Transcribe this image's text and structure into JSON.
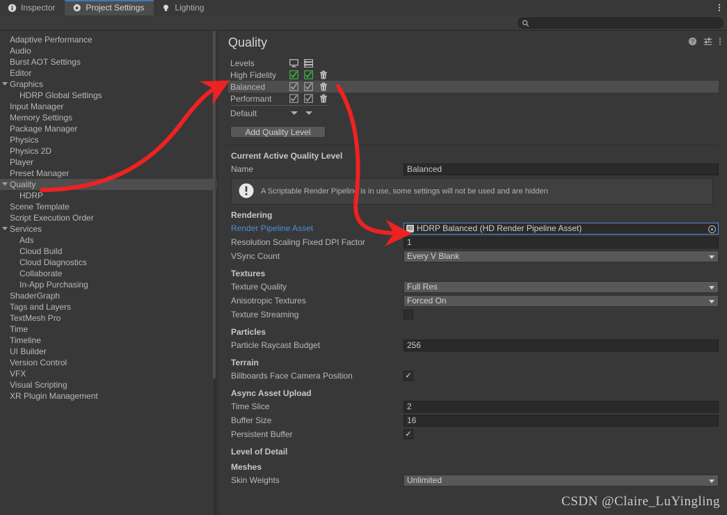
{
  "window": {
    "tabs": [
      {
        "label": "Inspector",
        "icon": "info-icon",
        "active": false
      },
      {
        "label": "Project Settings",
        "icon": "gear-icon",
        "active": true
      },
      {
        "label": "Lighting",
        "icon": "lightbulb-icon",
        "active": false
      }
    ],
    "menu_icon": "kebab-menu-icon"
  },
  "search": {
    "value": "",
    "placeholder": "",
    "icon": "search-icon"
  },
  "sidebar": {
    "items": [
      {
        "label": "Adaptive Performance",
        "indent": 0,
        "expandable": false,
        "selected": false
      },
      {
        "label": "Audio",
        "indent": 0,
        "expandable": false,
        "selected": false
      },
      {
        "label": "Burst AOT Settings",
        "indent": 0,
        "expandable": false,
        "selected": false
      },
      {
        "label": "Editor",
        "indent": 0,
        "expandable": false,
        "selected": false
      },
      {
        "label": "Graphics",
        "indent": 0,
        "expandable": true,
        "selected": false
      },
      {
        "label": "HDRP Global Settings",
        "indent": 1,
        "expandable": false,
        "selected": false
      },
      {
        "label": "Input Manager",
        "indent": 0,
        "expandable": false,
        "selected": false
      },
      {
        "label": "Memory Settings",
        "indent": 0,
        "expandable": false,
        "selected": false
      },
      {
        "label": "Package Manager",
        "indent": 0,
        "expandable": false,
        "selected": false
      },
      {
        "label": "Physics",
        "indent": 0,
        "expandable": false,
        "selected": false
      },
      {
        "label": "Physics 2D",
        "indent": 0,
        "expandable": false,
        "selected": false
      },
      {
        "label": "Player",
        "indent": 0,
        "expandable": false,
        "selected": false
      },
      {
        "label": "Preset Manager",
        "indent": 0,
        "expandable": false,
        "selected": false
      },
      {
        "label": "Quality",
        "indent": 0,
        "expandable": true,
        "selected": true
      },
      {
        "label": "HDRP",
        "indent": 1,
        "expandable": false,
        "selected": false
      },
      {
        "label": "Scene Template",
        "indent": 0,
        "expandable": false,
        "selected": false
      },
      {
        "label": "Script Execution Order",
        "indent": 0,
        "expandable": false,
        "selected": false
      },
      {
        "label": "Services",
        "indent": 0,
        "expandable": true,
        "selected": false
      },
      {
        "label": "Ads",
        "indent": 1,
        "expandable": false,
        "selected": false
      },
      {
        "label": "Cloud Build",
        "indent": 1,
        "expandable": false,
        "selected": false
      },
      {
        "label": "Cloud Diagnostics",
        "indent": 1,
        "expandable": false,
        "selected": false
      },
      {
        "label": "Collaborate",
        "indent": 1,
        "expandable": false,
        "selected": false
      },
      {
        "label": "In-App Purchasing",
        "indent": 1,
        "expandable": false,
        "selected": false
      },
      {
        "label": "ShaderGraph",
        "indent": 0,
        "expandable": false,
        "selected": false
      },
      {
        "label": "Tags and Layers",
        "indent": 0,
        "expandable": false,
        "selected": false
      },
      {
        "label": "TextMesh Pro",
        "indent": 0,
        "expandable": false,
        "selected": false
      },
      {
        "label": "Time",
        "indent": 0,
        "expandable": false,
        "selected": false
      },
      {
        "label": "Timeline",
        "indent": 0,
        "expandable": false,
        "selected": false
      },
      {
        "label": "UI Builder",
        "indent": 0,
        "expandable": false,
        "selected": false
      },
      {
        "label": "Version Control",
        "indent": 0,
        "expandable": false,
        "selected": false
      },
      {
        "label": "VFX",
        "indent": 0,
        "expandable": false,
        "selected": false
      },
      {
        "label": "Visual Scripting",
        "indent": 0,
        "expandable": false,
        "selected": false
      },
      {
        "label": "XR Plugin Management",
        "indent": 0,
        "expandable": false,
        "selected": false
      }
    ]
  },
  "panel": {
    "title": "Quality",
    "head_icons": [
      "help-icon",
      "preset-icon",
      "kebab-menu-icon"
    ]
  },
  "levels": {
    "header_label": "Levels",
    "col_icons": [
      "desktop-icon",
      "server-icon"
    ],
    "rows": [
      {
        "name": "High Fidelity",
        "desktop": true,
        "server": true,
        "green": true,
        "selected": false
      },
      {
        "name": "Balanced",
        "desktop": true,
        "server": true,
        "green": false,
        "selected": true
      },
      {
        "name": "Performant",
        "desktop": true,
        "server": true,
        "green": false,
        "selected": false
      }
    ],
    "default_label": "Default",
    "add_button": "Add Quality Level"
  },
  "active_level": {
    "section_title": "Current Active Quality Level",
    "name_label": "Name",
    "name_value": "Balanced",
    "help_message": "A Scriptable Render Pipeline is in use, some settings will not be used and are hidden",
    "help_icon": "warning-icon"
  },
  "sections": [
    {
      "title": "Rendering",
      "rows": [
        {
          "label": "Render Pipeline Asset",
          "type": "object",
          "value": "HDRP Balanced (HD Render Pipeline Asset)",
          "link": true,
          "focused": true
        },
        {
          "label": "Resolution Scaling Fixed DPI Factor",
          "type": "text",
          "value": "1"
        },
        {
          "label": "VSync Count",
          "type": "dropdown",
          "value": "Every V Blank"
        }
      ]
    },
    {
      "title": "Textures",
      "rows": [
        {
          "label": "Texture Quality",
          "type": "dropdown",
          "value": "Full Res"
        },
        {
          "label": "Anisotropic Textures",
          "type": "dropdown",
          "value": "Forced On"
        },
        {
          "label": "Texture Streaming",
          "type": "checkbox",
          "checked": false
        }
      ]
    },
    {
      "title": "Particles",
      "rows": [
        {
          "label": "Particle Raycast Budget",
          "type": "text",
          "value": "256"
        }
      ]
    },
    {
      "title": "Terrain",
      "rows": [
        {
          "label": "Billboards Face Camera Position",
          "type": "checkbox",
          "checked": true
        }
      ]
    },
    {
      "title": "Async Asset Upload",
      "rows": [
        {
          "label": "Time Slice",
          "type": "text",
          "value": "2"
        },
        {
          "label": "Buffer Size",
          "type": "text",
          "value": "16"
        },
        {
          "label": "Persistent Buffer",
          "type": "checkbox",
          "checked": true
        }
      ]
    },
    {
      "title": "Level of Detail",
      "rows": []
    },
    {
      "title": "Meshes",
      "rows": [
        {
          "label": "Skin Weights",
          "type": "dropdown",
          "value": "Unlimited"
        }
      ]
    }
  ],
  "annotations": {
    "color": "#ee2222",
    "arrows": [
      "quality-sidebar-to-levels",
      "levels-to-render-pipeline-asset"
    ]
  },
  "watermark": "CSDN @Claire_LuYingling"
}
